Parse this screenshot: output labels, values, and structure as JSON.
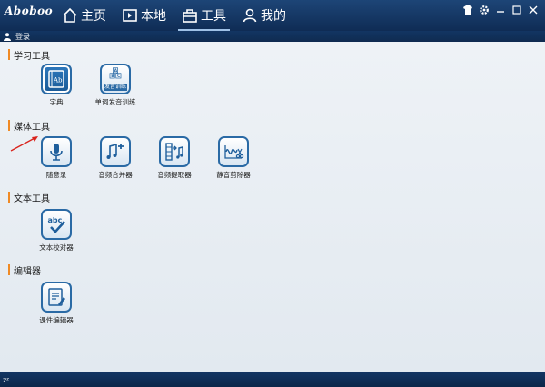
{
  "app": {
    "logo": "Aboboo"
  },
  "nav": {
    "items": [
      {
        "label": "主页",
        "icon": "home-icon"
      },
      {
        "label": "本地",
        "icon": "local-icon"
      },
      {
        "label": "工具",
        "icon": "toolbox-icon",
        "active": true
      },
      {
        "label": "我的",
        "icon": "user-icon"
      }
    ]
  },
  "window": {
    "controls": [
      "skin-icon",
      "settings-icon",
      "minimize-icon",
      "maximize-icon",
      "close-icon"
    ]
  },
  "user": {
    "login_label": "登录"
  },
  "sections": [
    {
      "title": "学习工具",
      "tools": [
        {
          "label": "字典",
          "icon": "dictionary-icon",
          "selected": true
        },
        {
          "label": "单词发音训练",
          "icon": "pronunciation-icon",
          "badge": "发音训练",
          "letters": [
            "A",
            "B",
            "C"
          ]
        }
      ]
    },
    {
      "title": "媒体工具",
      "tools": [
        {
          "label": "随意录",
          "icon": "microphone-icon"
        },
        {
          "label": "音频合并器",
          "icon": "audio-merge-icon"
        },
        {
          "label": "音频提取器",
          "icon": "audio-extract-icon"
        },
        {
          "label": "静音剪除器",
          "icon": "silence-cut-icon"
        }
      ]
    },
    {
      "title": "文本工具",
      "tools": [
        {
          "label": "文本校对器",
          "icon": "text-proofread-icon",
          "icon_text": "abc"
        }
      ]
    },
    {
      "title": "编辑器",
      "tools": [
        {
          "label": "课件编辑器",
          "icon": "courseware-editor-icon"
        }
      ]
    }
  ],
  "status": {
    "text": "zᶻ"
  },
  "colors": {
    "titlebar": "#1d4577",
    "accent": "#f08a24",
    "icon_border": "#2a6aa5",
    "arrow": "#d9231c"
  }
}
